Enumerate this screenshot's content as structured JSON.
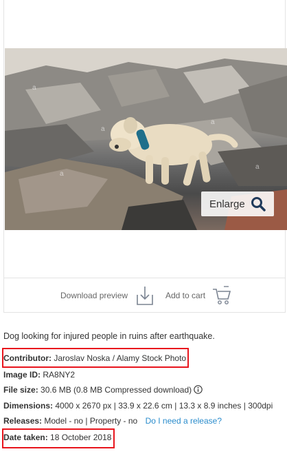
{
  "photo": {
    "alt": "Dog looking for injured people in ruins after earthquake",
    "enlarge_label": "Enlarge",
    "watermark": "a"
  },
  "actions": {
    "download_preview": "Download preview",
    "add_to_cart": "Add to cart"
  },
  "details": {
    "caption": "Dog looking for injured people in ruins after earthquake.",
    "contributor_label": "Contributor:",
    "contributor_value": "Jaroslav Noska / Alamy Stock Photo",
    "image_id_label": "Image ID:",
    "image_id_value": "RA8NY2",
    "file_size_label": "File size:",
    "file_size_value": "30.6 MB (0.8 MB Compressed download)",
    "dimensions_label": "Dimensions:",
    "dimensions_value": "4000 x 2670 px | 33.9 x 22.6 cm | 13.3 x 8.9 inches | 300dpi",
    "releases_label": "Releases:",
    "releases_value": "Model - no | Property - no",
    "release_link": "Do I need a release?",
    "date_label": "Date taken:",
    "date_value": "18 October 2018"
  },
  "colors": {
    "highlight": "#e8141c",
    "link": "#2a8ccc"
  }
}
